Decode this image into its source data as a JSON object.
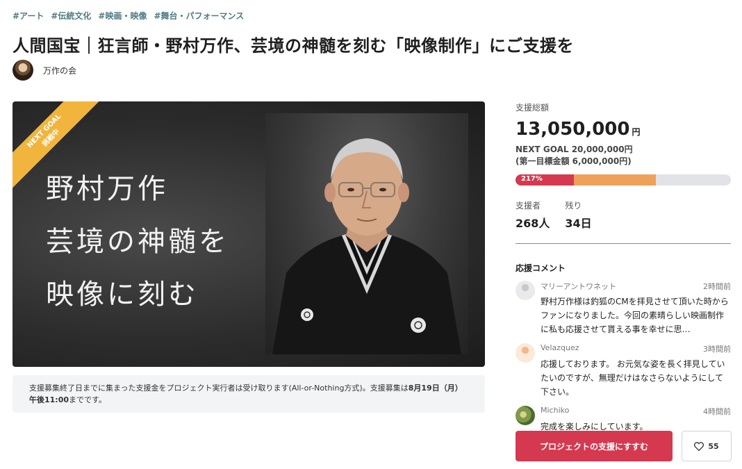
{
  "tags": [
    "#アート",
    "#伝統文化",
    "#映画・映像",
    "#舞台・パフォーマンス"
  ],
  "title": "人間国宝｜狂言師・野村万作、芸境の神髄を刻む「映像制作」にご支援を",
  "owner": {
    "name": "万作の会"
  },
  "hero": {
    "ribbon_line1": "NEXT GOAL",
    "ribbon_line2": "挑戦中",
    "text_lines": [
      "野村万作",
      "芸境の神髄を",
      "映像に刻む"
    ]
  },
  "notice": {
    "text_a": "支援募集終了日までに集まった支援金をプロジェクト実行者は受け取ります(All-or-Nothing方式)。支援募集は",
    "text_b": "8月19日（月）午後11:00",
    "text_c": "までです。"
  },
  "stats": {
    "total_label": "支援総額",
    "total_value": "13,050,000",
    "total_unit": "円",
    "next_goal": "NEXT GOAL 20,000,000円",
    "first_goal": "(第一目標金額 6,000,000円)",
    "progress_percent_label": "217%",
    "progress_first_goal_fraction": 0.27,
    "progress_next_goal_fraction": 0.65,
    "supporters_label": "支援者",
    "supporters_value": "268人",
    "remaining_label": "残り",
    "remaining_value": "34日"
  },
  "comments_section": {
    "heading": "応援コメント",
    "items": [
      {
        "user": "マリーアントワネット",
        "time": "2時間前",
        "text": "野村万作様は釣狐のCMを拝見させて頂いた時からファンになりました。今回の素晴らしい映画制作に私も応援させて貰える事を幸せに思…",
        "avatar": "av-gray"
      },
      {
        "user": "Velazquez",
        "time": "3時間前",
        "text": "応援しております。 お元気な姿を長く拝見していたいのですが、無理だけはなさらないようにして下さい。",
        "avatar": "av-peach"
      },
      {
        "user": "Michiko",
        "time": "4時間前",
        "text": "完成を楽しみにしています。",
        "avatar": "av-photo"
      }
    ]
  },
  "actions": {
    "support_label": "プロジェクトの支援にすすむ",
    "favorite_count": "55"
  },
  "colors": {
    "accent_red": "#d5394f",
    "progress_orange": "#efa15a",
    "tag_teal": "#4f7a82",
    "ribbon_yellow": "#f1b43c"
  }
}
